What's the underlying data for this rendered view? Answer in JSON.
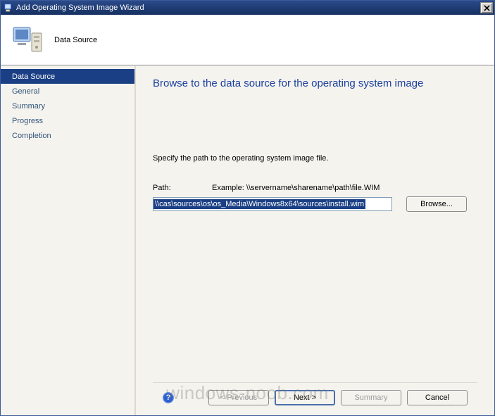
{
  "window": {
    "title": "Add Operating System Image Wizard"
  },
  "header": {
    "heading": "Data Source"
  },
  "sidebar": {
    "items": [
      {
        "label": "Data Source",
        "active": true
      },
      {
        "label": "General",
        "active": false
      },
      {
        "label": "Summary",
        "active": false
      },
      {
        "label": "Progress",
        "active": false
      },
      {
        "label": "Completion",
        "active": false
      }
    ]
  },
  "main": {
    "title": "Browse to the data source for the operating system image",
    "spec_text": "Specify the path to the operating system image file.",
    "path_label": "Path:",
    "example_text": "Example: \\\\servername\\sharename\\path\\file.WIM",
    "path_value": "\\\\cas\\sources\\os\\os_Media\\Windows8x64\\sources\\install.wim",
    "browse_label": "Browse..."
  },
  "footer": {
    "previous": "< Previous",
    "next": "Next >",
    "summary": "Summary",
    "cancel": "Cancel"
  },
  "watermark": "windows-noob.com"
}
